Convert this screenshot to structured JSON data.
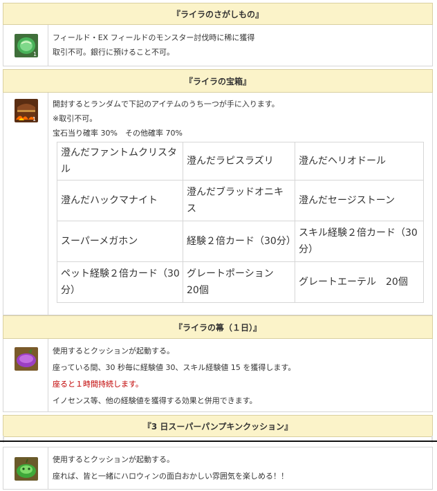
{
  "sections": [
    {
      "title": "『ライラのさがしもの』",
      "icon": "green-gem-icon",
      "icon_count": "1",
      "lines": [
        "フィールド・EX フィールドのモンスター討伐時に稀に獲得",
        "取引不可。銀行に預けること不可。"
      ]
    },
    {
      "title": "『ライラの宝箱』",
      "icon": "treasure-chest-icon",
      "icon_count": "1",
      "lines": [
        "開封するとランダムで下記のアイテムのうち一つが手に入ります。",
        "※取引不可。",
        "宝石当り確率 30%　その他確率 70%"
      ],
      "items": [
        [
          "澄んだファントムクリスタル",
          "澄んだラピスラズリ",
          "澄んだヘリオドール"
        ],
        [
          "澄んだハックマナイト",
          "澄んだブラッドオニキス",
          "澄んだセージストーン"
        ],
        [
          "スーパーメガホン",
          "経験２倍カード（30分）",
          "スキル経験２倍カード（30分）"
        ],
        [
          "ペット経験２倍カード（30分）",
          "グレートポーション　20個",
          "グレートエーテル　20個"
        ]
      ]
    },
    {
      "title": "『ライラの箒（１日）』",
      "icon": "purple-cushion-icon",
      "lines": [
        "使用するとクッションが起動する。",
        "座っている間、30 秒毎に経験値 30、スキル経験値 15 を獲得します。",
        "座ると１時間持続します。",
        "イノセンス等、他の経験値を獲得する効果と併用できます。"
      ]
    },
    {
      "title": "『3 日スーパーパンプキンクッション』",
      "icon": "green-pumpkin-cushion-icon",
      "lines": [
        "使用するとクッションが起動する。",
        "座れば、皆と一緒にハロウィンの面白おかしい雰囲気を楽しめる！！"
      ]
    }
  ],
  "colors": {
    "header_bg": "#fbf3c9",
    "warning_text": "#c00000"
  }
}
